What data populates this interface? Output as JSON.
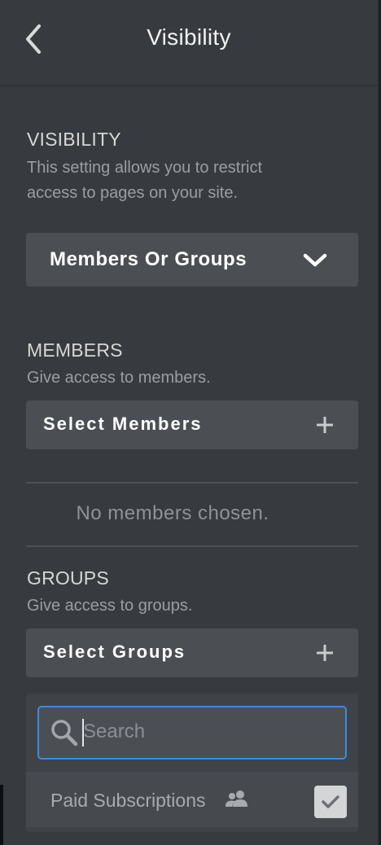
{
  "header": {
    "title": "Visibility",
    "back_icon": "chevron-left-icon"
  },
  "visibility": {
    "title": "VISIBILITY",
    "description_line1": "This setting allows you to restrict",
    "description_line2": "access to pages on your site.",
    "dropdown_value": "Members Or Groups"
  },
  "members": {
    "title": "MEMBERS",
    "description": "Give access to members.",
    "select_label": "Select Members",
    "empty_text": "No members chosen."
  },
  "groups": {
    "title": "GROUPS",
    "description": "Give access to groups.",
    "select_label": "Select Groups",
    "search_placeholder": "Search",
    "items": [
      {
        "label": "Paid Subscriptions",
        "icon": "group-icon",
        "checked": true
      }
    ]
  },
  "colors": {
    "panel_bg": "#373b3f",
    "button_bg": "#4b4f53",
    "focus_border": "#3a8be0"
  }
}
